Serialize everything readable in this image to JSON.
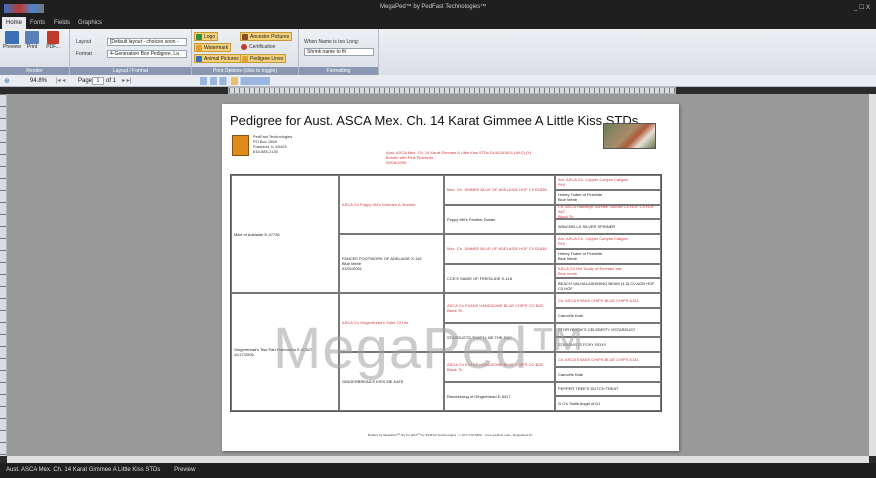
{
  "window": {
    "title": "MegaPed™ by PedFast Technologies™",
    "controls": "_ ☐ X"
  },
  "tabs": [
    "Home",
    "Fonts",
    "Fields",
    "Graphics"
  ],
  "ribbon": {
    "render": {
      "label": "Render",
      "preview": "Preview",
      "print": "Print",
      "pdf": "PDF..."
    },
    "layout": {
      "label": "Layout / Format",
      "layout_label": "Layout",
      "layout_value": "[Default layout - choices soon -",
      "format_label": "Format",
      "format_value": "4-Generation Box Pedigree, La"
    },
    "print_options": {
      "label": "Print Options (click to toggle)",
      "logo": "Logo",
      "watermark": "Watermark",
      "animal_pictures": "Animal Pictures",
      "ancestor_pictures": "Ancestor Pictures",
      "certification": "Certification",
      "pedigree_lines": "Pedigree Lines"
    },
    "formatting": {
      "label": "Formatting",
      "name_too_long": "When Name is too Long:",
      "shrink_value": "Shrink name to fit"
    }
  },
  "toolbar": {
    "zoom": "94.8%",
    "page_label": "Page",
    "page_value": "1",
    "of": "of 1"
  },
  "document": {
    "title": "Pedigree for Aust. ASCA Mex. Ch. 14 Karat Gimmee A Little Kiss STDs",
    "org": [
      "PedFast Technologies",
      "PO Box 1666",
      "Frankfort, IL 60423",
      "815-685-2130"
    ],
    "subject": [
      "Aust. ASCA Mex. Ch. 14 Karat Gimmee A Little Kiss STDs DL56341601 (AKC) (Y)",
      "Brindle with Pink Pinkeeds",
      "05/06/1995"
    ],
    "watermark": "MegaPed™",
    "footer": "Printed by MegaPed™ 3Q for iPad™ by PedFast Technologies - 1-815-759-8300 - www.pedfast.com - Registered To:",
    "gen1": [
      {
        "name": "Mike of Adelaide E-47726",
        "extra": ""
      },
      {
        "name": "Gingerbread's Two Part Harmonics E-80527",
        "extra": "11/17/2006"
      }
    ],
    "gen2": [
      {
        "name": "ASCA Ch Poppy Hill's Gimmee A Jimmee",
        "extra": ""
      },
      {
        "name": "FANCEE FOOTWORK OF ADELAIDE X-119",
        "extra": "Blue Merle\n01/01/2001"
      },
      {
        "name": "ASCA Ch Gingerbread's Sobe Of Life",
        "extra": ""
      },
      {
        "name": "GINGERBREAD'S KISS ME KATE",
        "extra": ""
      }
    ],
    "gen3": [
      {
        "name": "Mex. Ch. JIMMEE BLUE OF ADELAIDE HOF C9 B1838"
      },
      {
        "name": "Poppy Hill's Feather Duster"
      },
      {
        "name": "Mex. Ch. JIMMEE BLUE OF ADELAIDE HOF C9 B1838"
      },
      {
        "name": "CCK'S SADIE OF FIRESLIDE X-118"
      },
      {
        "name": "ASCA Ch EVANS HANDSOME BLUE CHIPS CO B2D",
        "extra": "Black Tri"
      },
      {
        "name": "STARDUSTS THAT'LL BE THE DAY"
      },
      {
        "name": "ASCA Ch EVANS HANDSOME BLUE CHIPS CO B2D",
        "extra": "Black Tri"
      },
      {
        "name": "Reminiscing of Gingerbread E-5417"
      }
    ],
    "gen4": [
      {
        "name": "Am. ASCA Ch. Copper Canyon Caligari",
        "extra": "RHI"
      },
      {
        "name": "Hobey Todee of Fireslide",
        "extra": "Blue Merle"
      },
      {
        "name": "Ch. ASCA Hawkeye Sunrise Sunrise C0 HOF C9 HOF A67",
        "extra": "Black Tri"
      },
      {
        "name": "WINCHELLS SILVER SPINNER"
      },
      {
        "name": "Am. ASCA Ch. Copper Canyon Caligari",
        "extra": "RHI"
      },
      {
        "name": "Hobey Todee of Fireslide",
        "extra": "Blue Merle"
      },
      {
        "name": "ASCA Ch Hot Toddy of Emerald Isle",
        "extra": "Blue merle"
      },
      {
        "name": "BEACH VALHALASHINING BEAM (4-5) C0 AGN HOF C0 HOF"
      },
      {
        "name": "Ch. ASCA EVANS CHIPS BLUE CHIPS A134"
      },
      {
        "name": "Camcefs Kate"
      },
      {
        "name": "STORYBOOK'S CELEBRITY OSTARDUST"
      },
      {
        "name": "STARDUSTS FOXY ROXY"
      },
      {
        "name": "Ch. ASCA EVANS CHIPS BLUE CHIPS A134"
      },
      {
        "name": "Camcefs Kate"
      },
      {
        "name": "PEPPER TREE'S DUTCH TREAT"
      },
      {
        "name": "G C's Twills Angel of DJ"
      }
    ]
  },
  "status": {
    "doc": "Aust. ASCA Mex. Ch. 14 Karat Gimmee A Little Kiss STDs",
    "mode": "Preview"
  }
}
